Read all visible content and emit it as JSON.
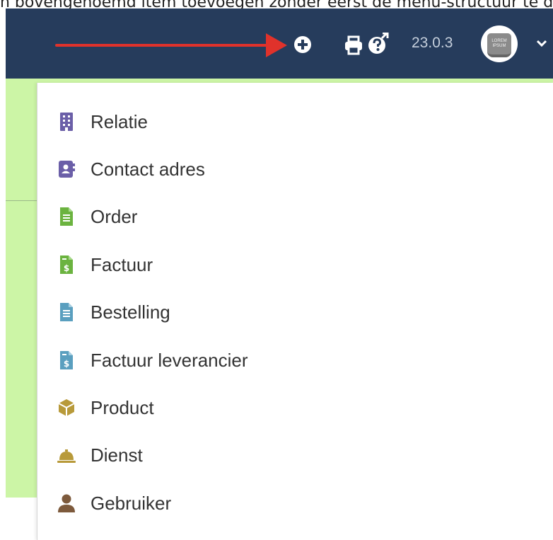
{
  "caption": "n bovengenoemd item toevoegen zonder eerst de menu-structuur te doorlopen",
  "header": {
    "add_icon": "plus-circle-icon",
    "print_icon": "printer-icon",
    "help_icon": "question-circle-icon",
    "version": "23.0.3",
    "avatar_text": "LOREM IPSUM",
    "dropdown_icon": "chevron-down-icon",
    "annotation": "red-arrow",
    "colors": {
      "bar": "#263c5c",
      "arrow": "#e0322b",
      "panel": "#ccf5a6"
    }
  },
  "menu": {
    "items": [
      {
        "label": "Relatie",
        "icon": "building-icon",
        "color": "#6b5fa8"
      },
      {
        "label": "Contact adres",
        "icon": "address-book-icon",
        "color": "#6b5fa8"
      },
      {
        "label": "Order",
        "icon": "file-text-icon",
        "color": "#6bb33f"
      },
      {
        "label": "Factuur",
        "icon": "file-invoice-dollar-icon",
        "color": "#6bb33f"
      },
      {
        "label": "Bestelling",
        "icon": "file-text-icon",
        "color": "#5a9fbf"
      },
      {
        "label": "Factuur leverancier",
        "icon": "file-invoice-dollar-icon",
        "color": "#5a9fbf"
      },
      {
        "label": "Product",
        "icon": "cube-icon",
        "color": "#b89a3a"
      },
      {
        "label": "Dienst",
        "icon": "concierge-bell-icon",
        "color": "#b89a3a"
      },
      {
        "label": "Gebruiker",
        "icon": "user-icon",
        "color": "#7d5a3c"
      }
    ]
  }
}
